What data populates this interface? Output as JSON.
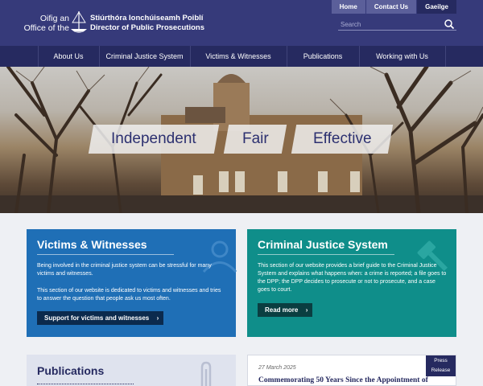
{
  "header": {
    "logo_left_line1": "Oifig an",
    "logo_left_line2": "Office of the",
    "logo_right_line1": "Stiúrthóra Ionchúiseamh Poiblí",
    "logo_right_line2": "Director of Public Prosecutions",
    "top_links": [
      "Home",
      "Contact Us",
      "Gaeilge"
    ],
    "search_placeholder": "Search"
  },
  "nav": {
    "items": [
      "About Us",
      "Criminal Justice System",
      "Victims & Witnesses",
      "Publications",
      "Working with Us"
    ]
  },
  "hero": {
    "words": [
      "Independent",
      "Fair",
      "Effective"
    ]
  },
  "victims_card": {
    "title": "Victims & Witnesses",
    "para1": "Being involved in the criminal justice system can be stressful for many victims and witnesses.",
    "para2": "This section of our website is dedicated to victims and witnesses and tries to answer the question that people ask us most often.",
    "button": "Support for victims and witnesses",
    "icon": "person-icon",
    "color": "#1f6fb6"
  },
  "cjs_card": {
    "title": "Criminal Justice System",
    "para1": "This section of our website provides a brief guide to the Criminal Justice System and explains what happens when: a crime is reported; a file goes to the DPP; the DPP decides to prosecute or not to prosecute, and a case goes to court.",
    "button": "Read more",
    "icon": "gavel-icon",
    "color": "#0f8e8a"
  },
  "publications_card": {
    "title": "Publications",
    "icon": "paperclip-icon"
  },
  "news_card": {
    "date": "27 March 2025",
    "title": "Commemorating 50 Years Since the Appointment of",
    "badge_line1": "Press",
    "badge_line2": "Release"
  },
  "colors": {
    "header": "#363a7a",
    "nav": "#262a60",
    "accent_blue": "#1f6fb6",
    "accent_teal": "#0f8e8a"
  }
}
